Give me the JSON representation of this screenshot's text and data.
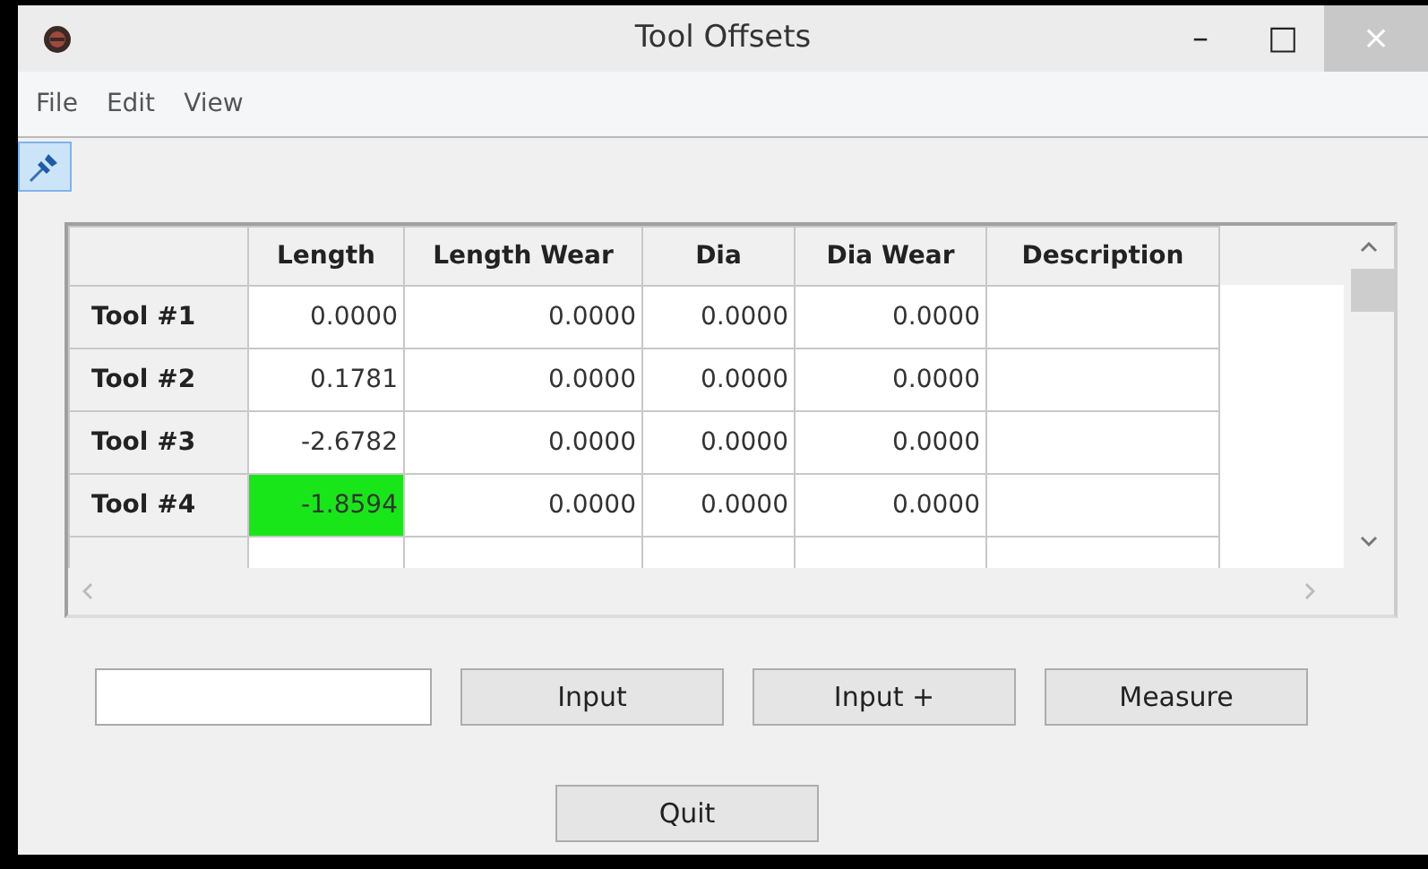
{
  "window": {
    "title": "Tool Offsets",
    "controls": [
      "–",
      "□",
      "×"
    ]
  },
  "menu": [
    "File",
    "Edit",
    "View"
  ],
  "toolbar": [
    {
      "kind": "pin",
      "selected": true
    }
  ],
  "table": {
    "columns": [
      "Length",
      "Length Wear",
      "Dia",
      "Dia Wear",
      "Description"
    ],
    "rows": [
      {
        "label": "Tool #1",
        "cells": [
          "0.0000",
          "0.0000",
          "0.0000",
          "0.0000"
        ],
        "highlighted": false
      },
      {
        "label": "Tool #2",
        "cells": [
          "0.1781",
          "0.0000",
          "0.0000",
          "0.0000"
        ],
        "highlighted": false
      },
      {
        "label": "Tool #3",
        "cells": [
          "-2.6782",
          "0.0000",
          "0.0000",
          "0.0000"
        ],
        "highlighted": false
      },
      {
        "label": "Tool #4",
        "cells": [
          "-1.8594",
          "0.0000",
          "0.0000",
          "0.0000"
        ],
        "highlighted": true
      }
    ]
  },
  "buttons": [
    "Input",
    "Input +",
    "Measure"
  ],
  "quit": "Quit"
}
